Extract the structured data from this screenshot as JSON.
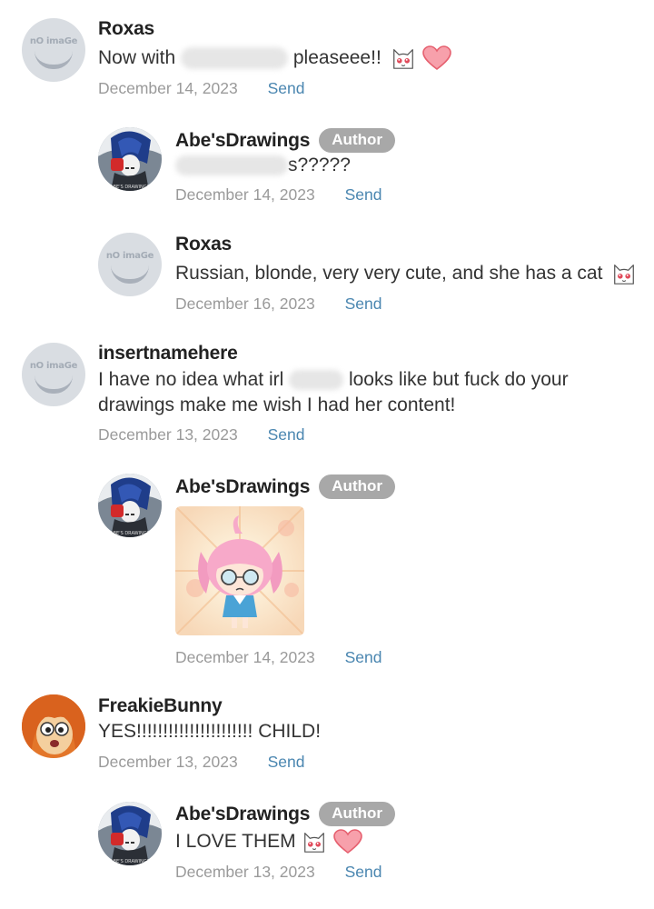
{
  "comments": [
    {
      "name": "Roxas",
      "text_before": "Now with ",
      "text_after": " pleaseee!!",
      "date": "December 14, 2023",
      "send": "Send"
    },
    {
      "name": "Abe'sDrawings",
      "badge": "Author",
      "text_after": "s?????",
      "date": "December 14, 2023",
      "send": "Send"
    },
    {
      "name": "Roxas",
      "text": "Russian, blonde, very very cute, and she has a cat",
      "date": "December 16, 2023",
      "send": "Send"
    },
    {
      "name": "insertnamehere",
      "line1_before": "I have no idea what irl ",
      "line1_after": " looks like but fuck do your",
      "line2": "drawings make me wish I had her content!",
      "date": "December 13, 2023",
      "send": "Send"
    },
    {
      "name": "Abe'sDrawings",
      "badge": "Author",
      "date": "December 14, 2023",
      "send": "Send"
    },
    {
      "name": "FreakieBunny",
      "text": "YES!!!!!!!!!!!!!!!!!!!!!! CHILD!",
      "date": "December 13, 2023",
      "send": "Send"
    },
    {
      "name": "Abe'sDrawings",
      "badge": "Author",
      "text": "I LOVE THEM",
      "date": "December 13, 2023",
      "send": "Send"
    }
  ],
  "placeholder_avatar_text": "nO imaGe",
  "colors": {
    "send_link": "#4a86b0",
    "badge_bg": "#a8a8a8",
    "date": "#9a9a9a",
    "heart": "#f27a8a"
  }
}
